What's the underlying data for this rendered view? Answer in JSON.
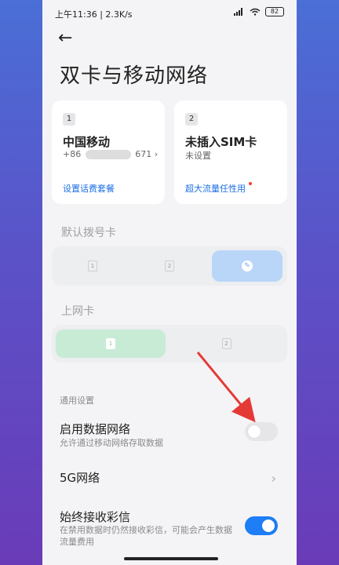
{
  "status_bar": {
    "time_speed": "上午11:36 | 2.3K/s",
    "battery": "82"
  },
  "page": {
    "title": "双卡与移动网络"
  },
  "sim_cards": [
    {
      "slot": "1",
      "carrier": "中国移动",
      "number_prefix": "+86",
      "number_suffix": "671",
      "link": "设置话费套餐"
    },
    {
      "slot": "2",
      "carrier": "未插入SIM卡",
      "status": "未设置",
      "link": "超大流量任性用"
    }
  ],
  "default_dial": {
    "label": "默认拨号卡",
    "options": [
      "1",
      "2",
      "edit"
    ]
  },
  "data_card": {
    "label": "上网卡",
    "options": [
      "1",
      "2"
    ]
  },
  "general": {
    "section_label": "通用设置",
    "rows": [
      {
        "title": "启用数据网络",
        "subtitle": "允许通过移动网络存取数据",
        "toggle": "off"
      },
      {
        "title": "5G网络"
      },
      {
        "title": "始终接收彩信",
        "subtitle": "在禁用数据时仍然接收彩信，可能会产生数据流量费用",
        "toggle": "on"
      }
    ]
  },
  "colors": {
    "accent": "#1d7ef5",
    "data_selected": "#c8ebd6",
    "dial_selected": "#b9d6f9",
    "arrow": "#e53935"
  }
}
